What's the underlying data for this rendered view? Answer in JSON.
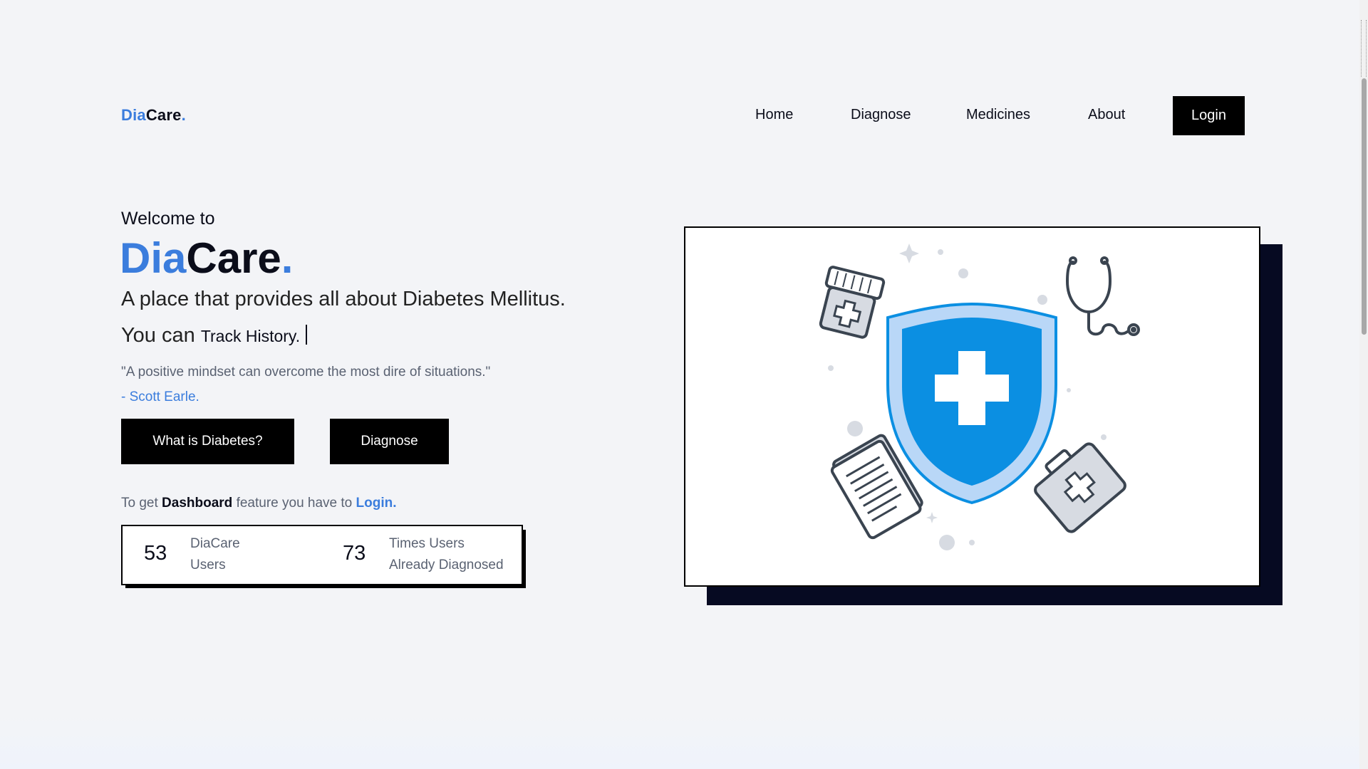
{
  "header": {
    "logo": {
      "part1": "Dia",
      "part2": "Care",
      "dot": "."
    },
    "nav": [
      {
        "label": "Home"
      },
      {
        "label": "Diagnose"
      },
      {
        "label": "Medicines"
      },
      {
        "label": "About"
      }
    ],
    "login_label": "Login"
  },
  "hero": {
    "welcome": "Welcome to",
    "brand": {
      "part1": "Dia",
      "part2": "Care",
      "dot": "."
    },
    "tagline": "A place that provides all about Diabetes Mellitus.",
    "you_can": "You can",
    "typed_text": "Track History.",
    "quote": "\"A positive mindset can overcome the most dire of situations.\"",
    "author": "- Scott Earle.",
    "buttons": {
      "what_is": "What is Diabetes?",
      "diagnose": "Diagnose"
    },
    "dashboard_note": {
      "prefix": "To get",
      "feature": "Dashboard",
      "middle": "feature you have to",
      "link": "Login."
    }
  },
  "stats": [
    {
      "value": "53",
      "label_line1": "DiaCare",
      "label_line2": "Users"
    },
    {
      "value": "73",
      "label_line1": "Times Users",
      "label_line2": "Already Diagnosed"
    }
  ],
  "illustration": {
    "icons": [
      "shield-plus-icon",
      "pill-bottle-icon",
      "stethoscope-icon",
      "clipboard-icon",
      "medical-kit-icon"
    ],
    "colors": {
      "shield_blue": "#0b8fe2",
      "shield_light": "#b9d7f7",
      "outline": "#3a4450",
      "gray": "#d7dbe2"
    }
  },
  "colors": {
    "accent": "#3b7ddd",
    "primary": "#000000",
    "text": "#0b0d1a",
    "muted": "#5a6272"
  }
}
